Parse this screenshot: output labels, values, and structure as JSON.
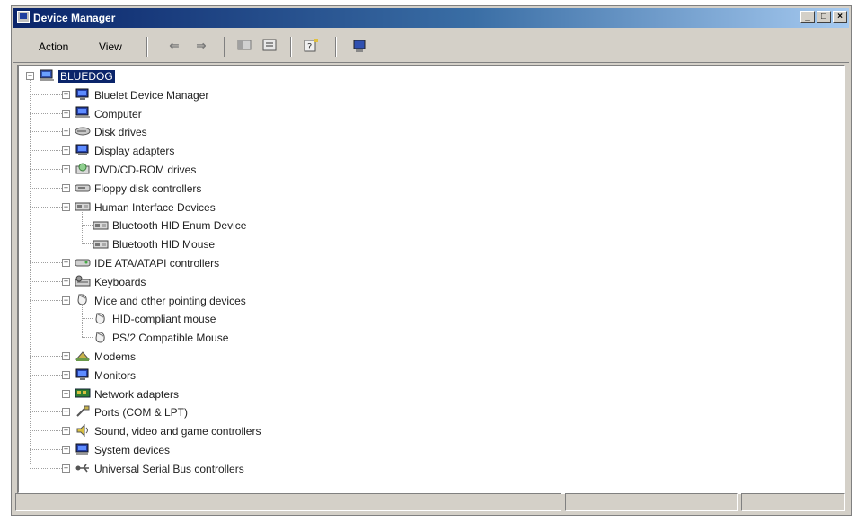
{
  "window": {
    "title": "Device Manager"
  },
  "toolbar": {
    "action_label": "Action",
    "view_label": "View",
    "back_icon": "back-arrow-icon",
    "forward_icon": "forward-arrow-icon"
  },
  "tree": {
    "root": "BLUEDOG",
    "items": [
      {
        "label": "Bluelet Device Manager",
        "icon": "monitor-icon",
        "expanded": false
      },
      {
        "label": "Computer",
        "icon": "computer-icon",
        "expanded": false
      },
      {
        "label": "Disk drives",
        "icon": "disk-drive-icon",
        "expanded": false
      },
      {
        "label": "Display adapters",
        "icon": "display-adapter-icon",
        "expanded": false
      },
      {
        "label": "DVD/CD-ROM drives",
        "icon": "cdrom-icon",
        "expanded": false
      },
      {
        "label": "Floppy disk controllers",
        "icon": "floppy-controller-icon",
        "expanded": false
      },
      {
        "label": "Human Interface Devices",
        "icon": "hid-icon",
        "expanded": true,
        "children": [
          "Bluetooth HID Enum Device",
          "Bluetooth HID Mouse"
        ]
      },
      {
        "label": "IDE ATA/ATAPI controllers",
        "icon": "ide-controller-icon",
        "expanded": false
      },
      {
        "label": "Keyboards",
        "icon": "keyboard-icon",
        "expanded": false
      },
      {
        "label": "Mice and other pointing devices",
        "icon": "mouse-icon",
        "expanded": true,
        "children": [
          "HID-compliant mouse",
          "PS/2 Compatible Mouse"
        ]
      },
      {
        "label": "Modems",
        "icon": "modem-icon",
        "expanded": false
      },
      {
        "label": "Monitors",
        "icon": "monitor-icon",
        "expanded": false
      },
      {
        "label": "Network adapters",
        "icon": "network-adapter-icon",
        "expanded": false
      },
      {
        "label": "Ports (COM & LPT)",
        "icon": "port-icon",
        "expanded": false
      },
      {
        "label": "Sound, video and game controllers",
        "icon": "sound-icon",
        "expanded": false
      },
      {
        "label": "System devices",
        "icon": "system-device-icon",
        "expanded": false
      },
      {
        "label": "Universal Serial Bus controllers",
        "icon": "usb-icon",
        "expanded": false
      }
    ]
  },
  "colors": {
    "selection": "#0a246a",
    "title_start": "#0a246a",
    "title_end": "#a6caf0",
    "chrome": "#d4d0c8"
  }
}
